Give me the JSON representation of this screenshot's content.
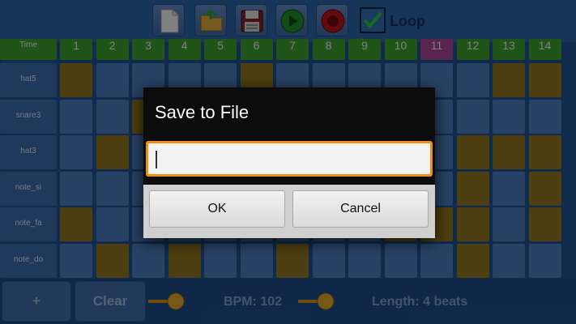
{
  "toolbar": {
    "buttons": [
      {
        "name": "new-file-icon"
      },
      {
        "name": "open-folder-icon"
      },
      {
        "name": "save-floppy-icon"
      },
      {
        "name": "play-icon"
      },
      {
        "name": "record-icon"
      }
    ],
    "loop": {
      "label": "Loop",
      "checked": true
    }
  },
  "grid": {
    "corner_label": "Time",
    "columns": [
      "1",
      "2",
      "3",
      "4",
      "5",
      "6",
      "7",
      "8",
      "9",
      "10",
      "11",
      "12",
      "13",
      "14"
    ],
    "active_column": "11",
    "rows": [
      {
        "label": "hat5",
        "cells": [
          1,
          0,
          0,
          0,
          0,
          1,
          0,
          0,
          0,
          0,
          0,
          0,
          1,
          1
        ]
      },
      {
        "label": "snare3",
        "cells": [
          0,
          0,
          1,
          0,
          0,
          0,
          0,
          0,
          0,
          0,
          0,
          0,
          0,
          0
        ]
      },
      {
        "label": "hat3",
        "cells": [
          0,
          1,
          0,
          0,
          0,
          0,
          0,
          0,
          0,
          0,
          0,
          1,
          1,
          1
        ]
      },
      {
        "label": "note_si",
        "cells": [
          0,
          0,
          0,
          0,
          0,
          0,
          0,
          0,
          0,
          0,
          0,
          1,
          0,
          1
        ]
      },
      {
        "label": "note_fa",
        "cells": [
          1,
          0,
          0,
          0,
          0,
          0,
          0,
          0,
          0,
          1,
          1,
          1,
          0,
          1
        ]
      },
      {
        "label": "note_do",
        "cells": [
          0,
          1,
          0,
          1,
          0,
          0,
          1,
          0,
          0,
          0,
          0,
          1,
          0,
          0
        ]
      }
    ],
    "colors": {
      "empty": "#4a79b8",
      "on": "#8c7320",
      "header": "#3d9a2e",
      "active_header": "#a3448f"
    }
  },
  "bottom": {
    "add_label": "+",
    "clear_label": "Clear",
    "bpm_text": "BPM: 102",
    "length_text": "Length: 4 beats"
  },
  "dialog": {
    "title": "Save to File",
    "input_value": "",
    "ok_label": "OK",
    "cancel_label": "Cancel",
    "accent": "#f08c18"
  }
}
